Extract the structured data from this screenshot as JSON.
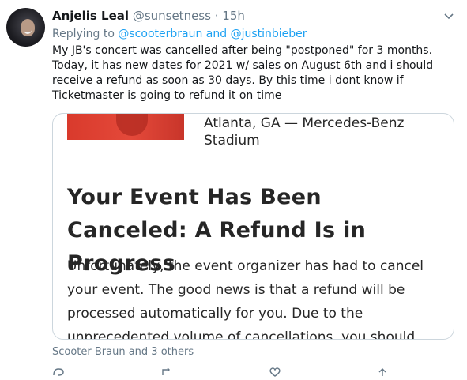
{
  "tweet": {
    "author_name": "Anjelis Leal",
    "author_handle": "@sunsetness",
    "separator": "·",
    "timestamp": "15h",
    "replying_prefix": "Replying to",
    "replying_to_1": "@scooterbraun",
    "replying_and": "and",
    "replying_to_2": "@justinbieber",
    "text": "My JB's concert was cancelled after being \"postponed\" for 3 months. Today, it has new dates for 2021 w/ sales on August 6th and i should receive a refund as soon as 30 days. By this time i dont know if Ticketmaster is going to refund it on time"
  },
  "card": {
    "location": "Atlanta, GA — Mercedes-Benz Stadium",
    "title": "Your Event Has Been Canceled: A Refund Is in Progress",
    "body": "Unfortunately, the event organizer has had to cancel your event. The good news is that a refund will be processed automatically for you. Due to the unprecedented volume of cancellations, you should"
  },
  "footer": {
    "liked_by": "Scooter Braun and 3 others"
  },
  "icons": {
    "caret": "chevron-down-icon",
    "reply": "reply-icon",
    "retweet": "retweet-icon",
    "like": "heart-icon",
    "share": "share-icon"
  },
  "colors": {
    "link": "#1da1f2",
    "muted": "#657786",
    "border": "#ccd6dd",
    "image_red": "#d93a2c"
  }
}
